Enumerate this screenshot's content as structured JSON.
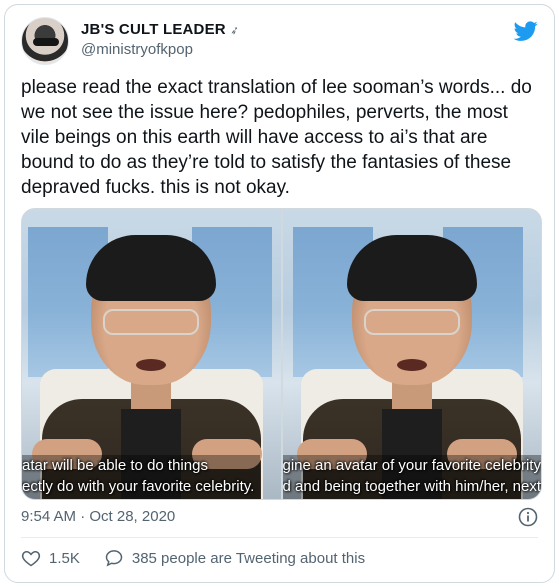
{
  "tweet": {
    "display_name": "JB'S CULT LEADER",
    "name_emoji_icon": "small-bird-emoji",
    "handle": "@ministryofkpop",
    "text": "please read the exact translation of lee sooman’s words... do we not see the issue here? pedophiles, perverts, the most vile beings on this earth will have access to ai’s that are bound to do as they’re told to satisfy the fantasies of these  depraved fucks. this is not okay.",
    "timestamp": "9:54 AM · Oct 28, 2020",
    "likes": "1.5K",
    "tweeting_about": "385 people are Tweeting about this"
  },
  "media": {
    "left_caption_line1": "atar will be able to do things",
    "left_caption_line2": "ectly do with your favorite celebrity.",
    "right_caption_line1": "gine an avatar of your favorite celebrity",
    "right_caption_line2": "d and being together with him/her, next"
  },
  "colors": {
    "twitter_blue": "#1d9bf0",
    "secondary_text": "#536471",
    "border": "#cfd9de"
  },
  "icons": {
    "brand": "twitter-bird-icon",
    "info": "info-icon",
    "like": "heart-icon",
    "conversation": "speech-bubble-icon"
  }
}
